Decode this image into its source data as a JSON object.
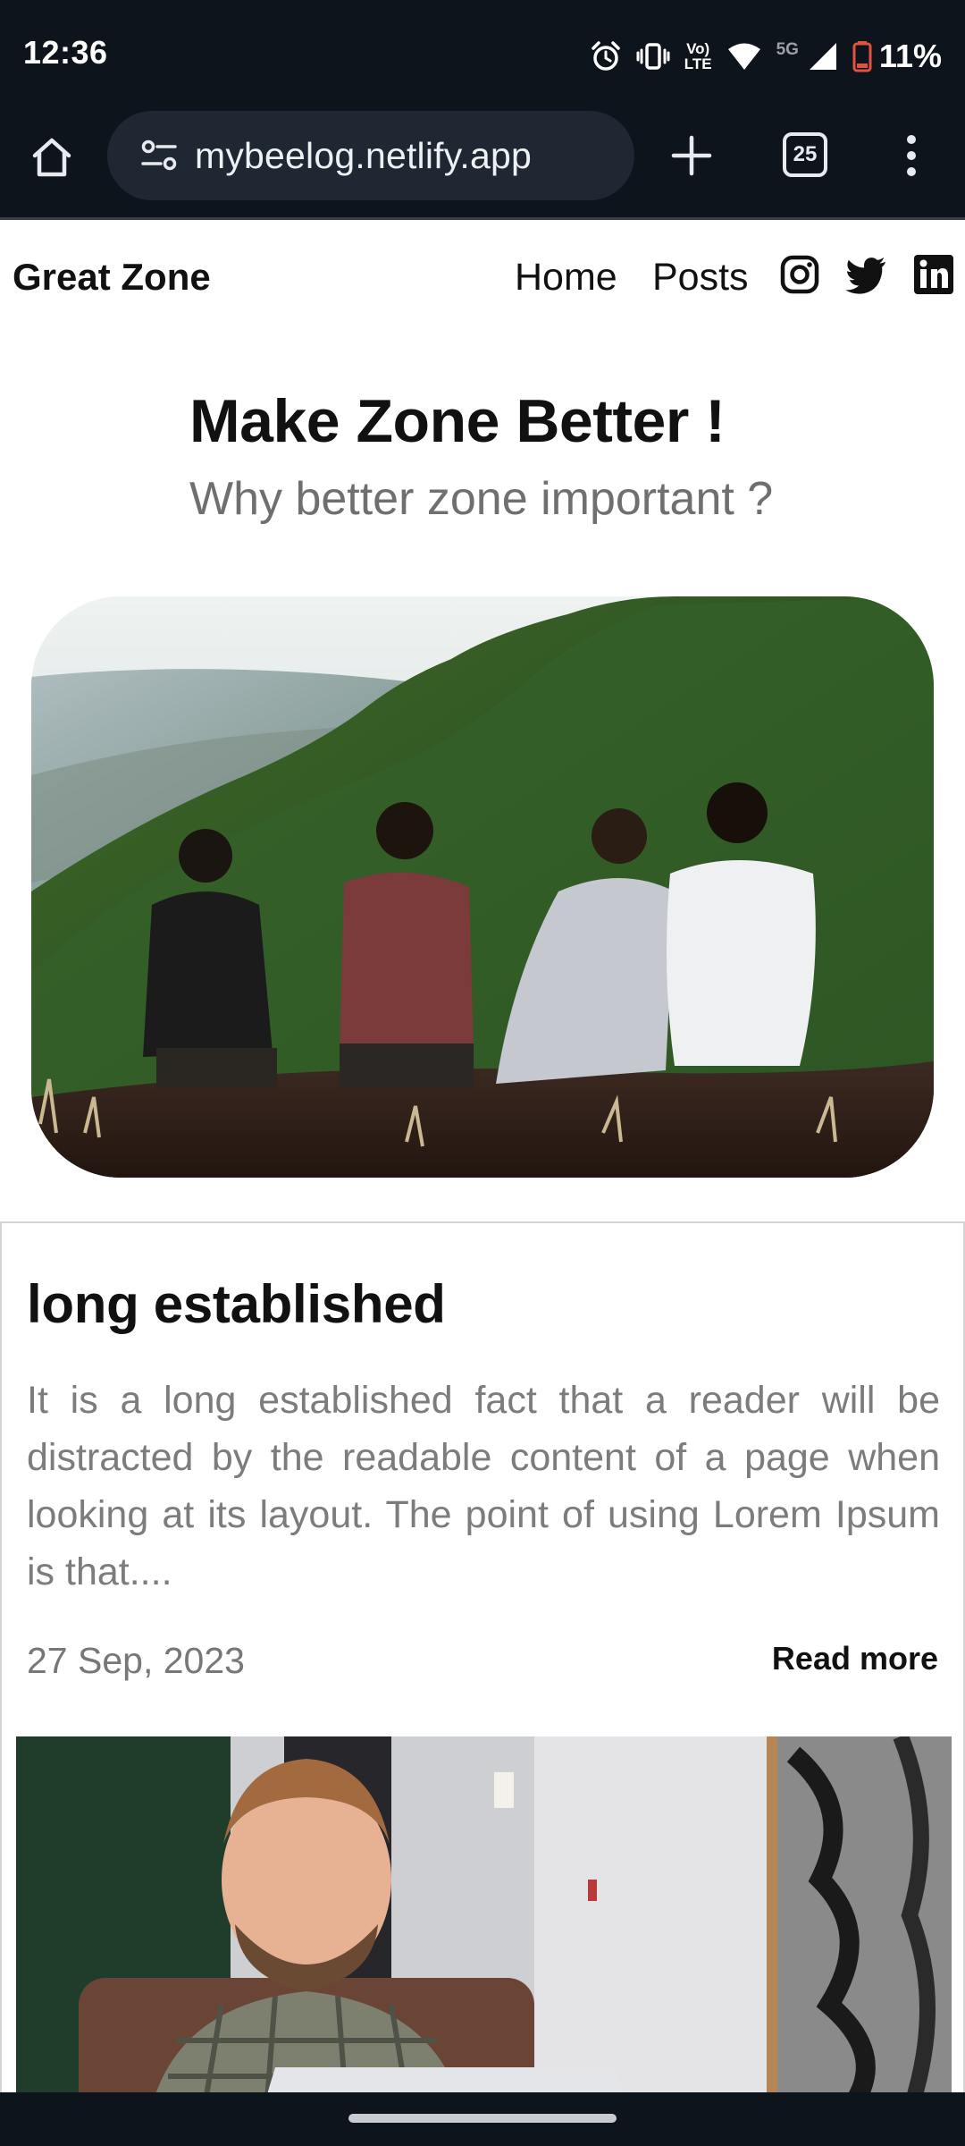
{
  "status_bar": {
    "time": "12:36",
    "network_label_top": "Vo)",
    "network_label_bottom": "LTE",
    "network_type": "5G",
    "battery": "11%"
  },
  "browser": {
    "url": "mybeelog.netlify.app",
    "tab_count": "25"
  },
  "site": {
    "brand": "Great Zone",
    "nav": {
      "home": "Home",
      "posts": "Posts"
    },
    "social_icons": [
      "instagram-icon",
      "twitter-icon",
      "linkedin-icon"
    ]
  },
  "hero": {
    "title": "Make Zone Better !",
    "subtitle": "Why better zone important ?"
  },
  "post": {
    "title": "long established",
    "excerpt": "It is a long established fact that a reader will be distracted by the readable content of a page when looking at its layout. The point of using Lorem Ipsum is that....",
    "date": "27 Sep, 2023",
    "read_more": "Read more"
  },
  "colors": {
    "chrome_background": "#0e141c",
    "omnibox": "#1e2732",
    "subtitle_gray": "#6f6f6f",
    "excerpt_gray": "#7c7c7c"
  }
}
